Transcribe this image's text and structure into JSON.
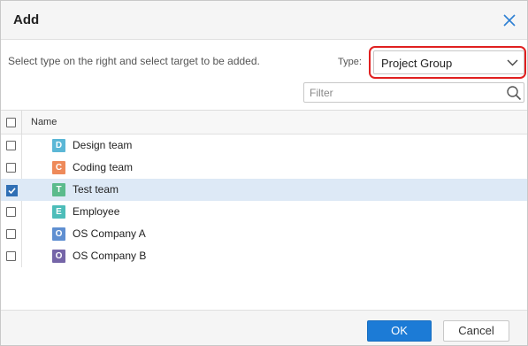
{
  "dialog": {
    "title": "Add",
    "instruction": "Select type on the right and select target to be added.",
    "type_label": "Type:",
    "type_value": "Project Group",
    "filter_placeholder": "Filter"
  },
  "grid": {
    "header": "Name",
    "rows": [
      {
        "letter": "D",
        "label": "Design team",
        "color": "#5bb7d6",
        "checked": false
      },
      {
        "letter": "C",
        "label": "Coding team",
        "color": "#ee8a5a",
        "checked": false
      },
      {
        "letter": "T",
        "label": "Test team",
        "color": "#5bbb8c",
        "checked": true
      },
      {
        "letter": "E",
        "label": "Employee",
        "color": "#4dbdb9",
        "checked": false
      },
      {
        "letter": "O",
        "label": "OS Company A",
        "color": "#5f8fd1",
        "checked": false
      },
      {
        "letter": "O",
        "label": "OS Company B",
        "color": "#7565a8",
        "checked": false
      }
    ]
  },
  "footer": {
    "ok_label": "OK",
    "cancel_label": "Cancel"
  },
  "colors": {
    "accent": "#1c7bd6",
    "selected_row": "#dde9f6",
    "highlight": "#e02020"
  },
  "icons": {
    "close": "close-icon",
    "dropdown": "chevron-down-icon",
    "search": "search-icon",
    "check": "checkmark-icon"
  }
}
